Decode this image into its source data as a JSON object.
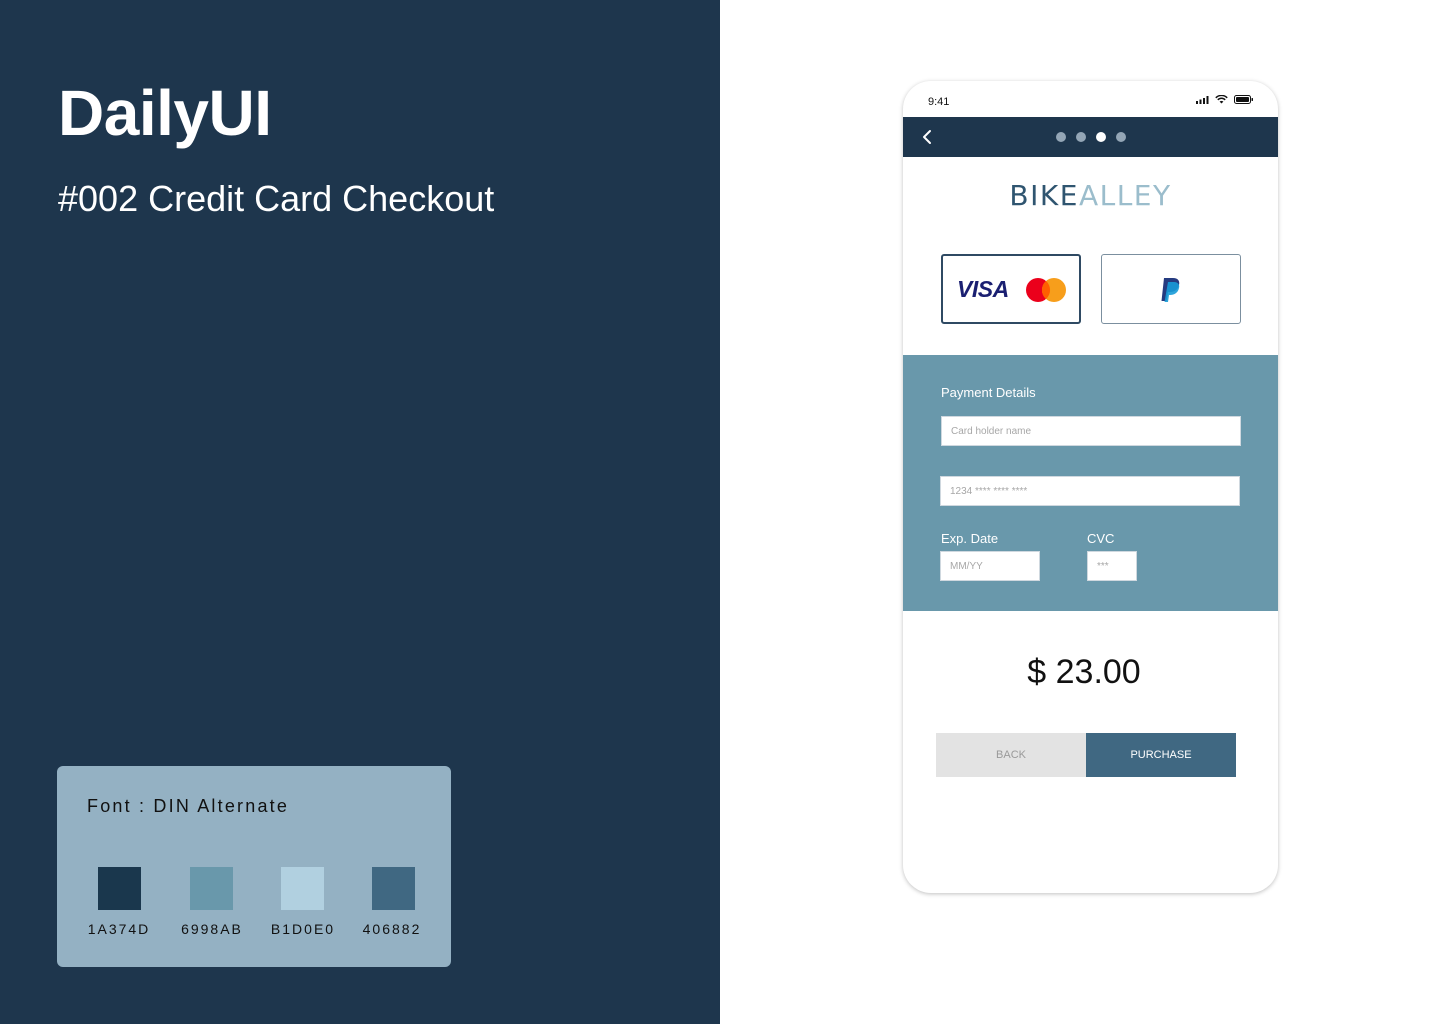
{
  "left": {
    "title": "DailyUI",
    "subtitle": "#002 Credit Card Checkout",
    "font_label": "Font : DIN Alternate",
    "swatches": [
      {
        "code": "1A374D",
        "color": "#1a374d"
      },
      {
        "code": "6998AB",
        "color": "#6998ab"
      },
      {
        "code": "B1D0E0",
        "color": "#b1d0e0"
      },
      {
        "code": "406882",
        "color": "#406882"
      }
    ]
  },
  "phone": {
    "status_time": "9:41",
    "nav": {
      "steps": 4,
      "active_step": 3
    },
    "brand": {
      "part1": "BIKE",
      "part2": "ALLEY"
    },
    "payment_options": [
      {
        "label": "VISA",
        "selected": true
      },
      {
        "label": "PayPal",
        "selected": false
      }
    ],
    "payment": {
      "title": "Payment Details",
      "card_holder_placeholder": "Card holder name",
      "card_number_placeholder": "1234 **** **** ****",
      "exp_label": "Exp. Date",
      "exp_placeholder": "MM/YY",
      "cvc_label": "CVC",
      "cvc_placeholder": "***"
    },
    "price": "$ 23.00",
    "buttons": {
      "back": "BACK",
      "purchase": "PURCHASE"
    }
  },
  "colors": {
    "dark": "#1a374d",
    "mid": "#6998ab",
    "light": "#b1d0e0",
    "accent": "#406882"
  }
}
